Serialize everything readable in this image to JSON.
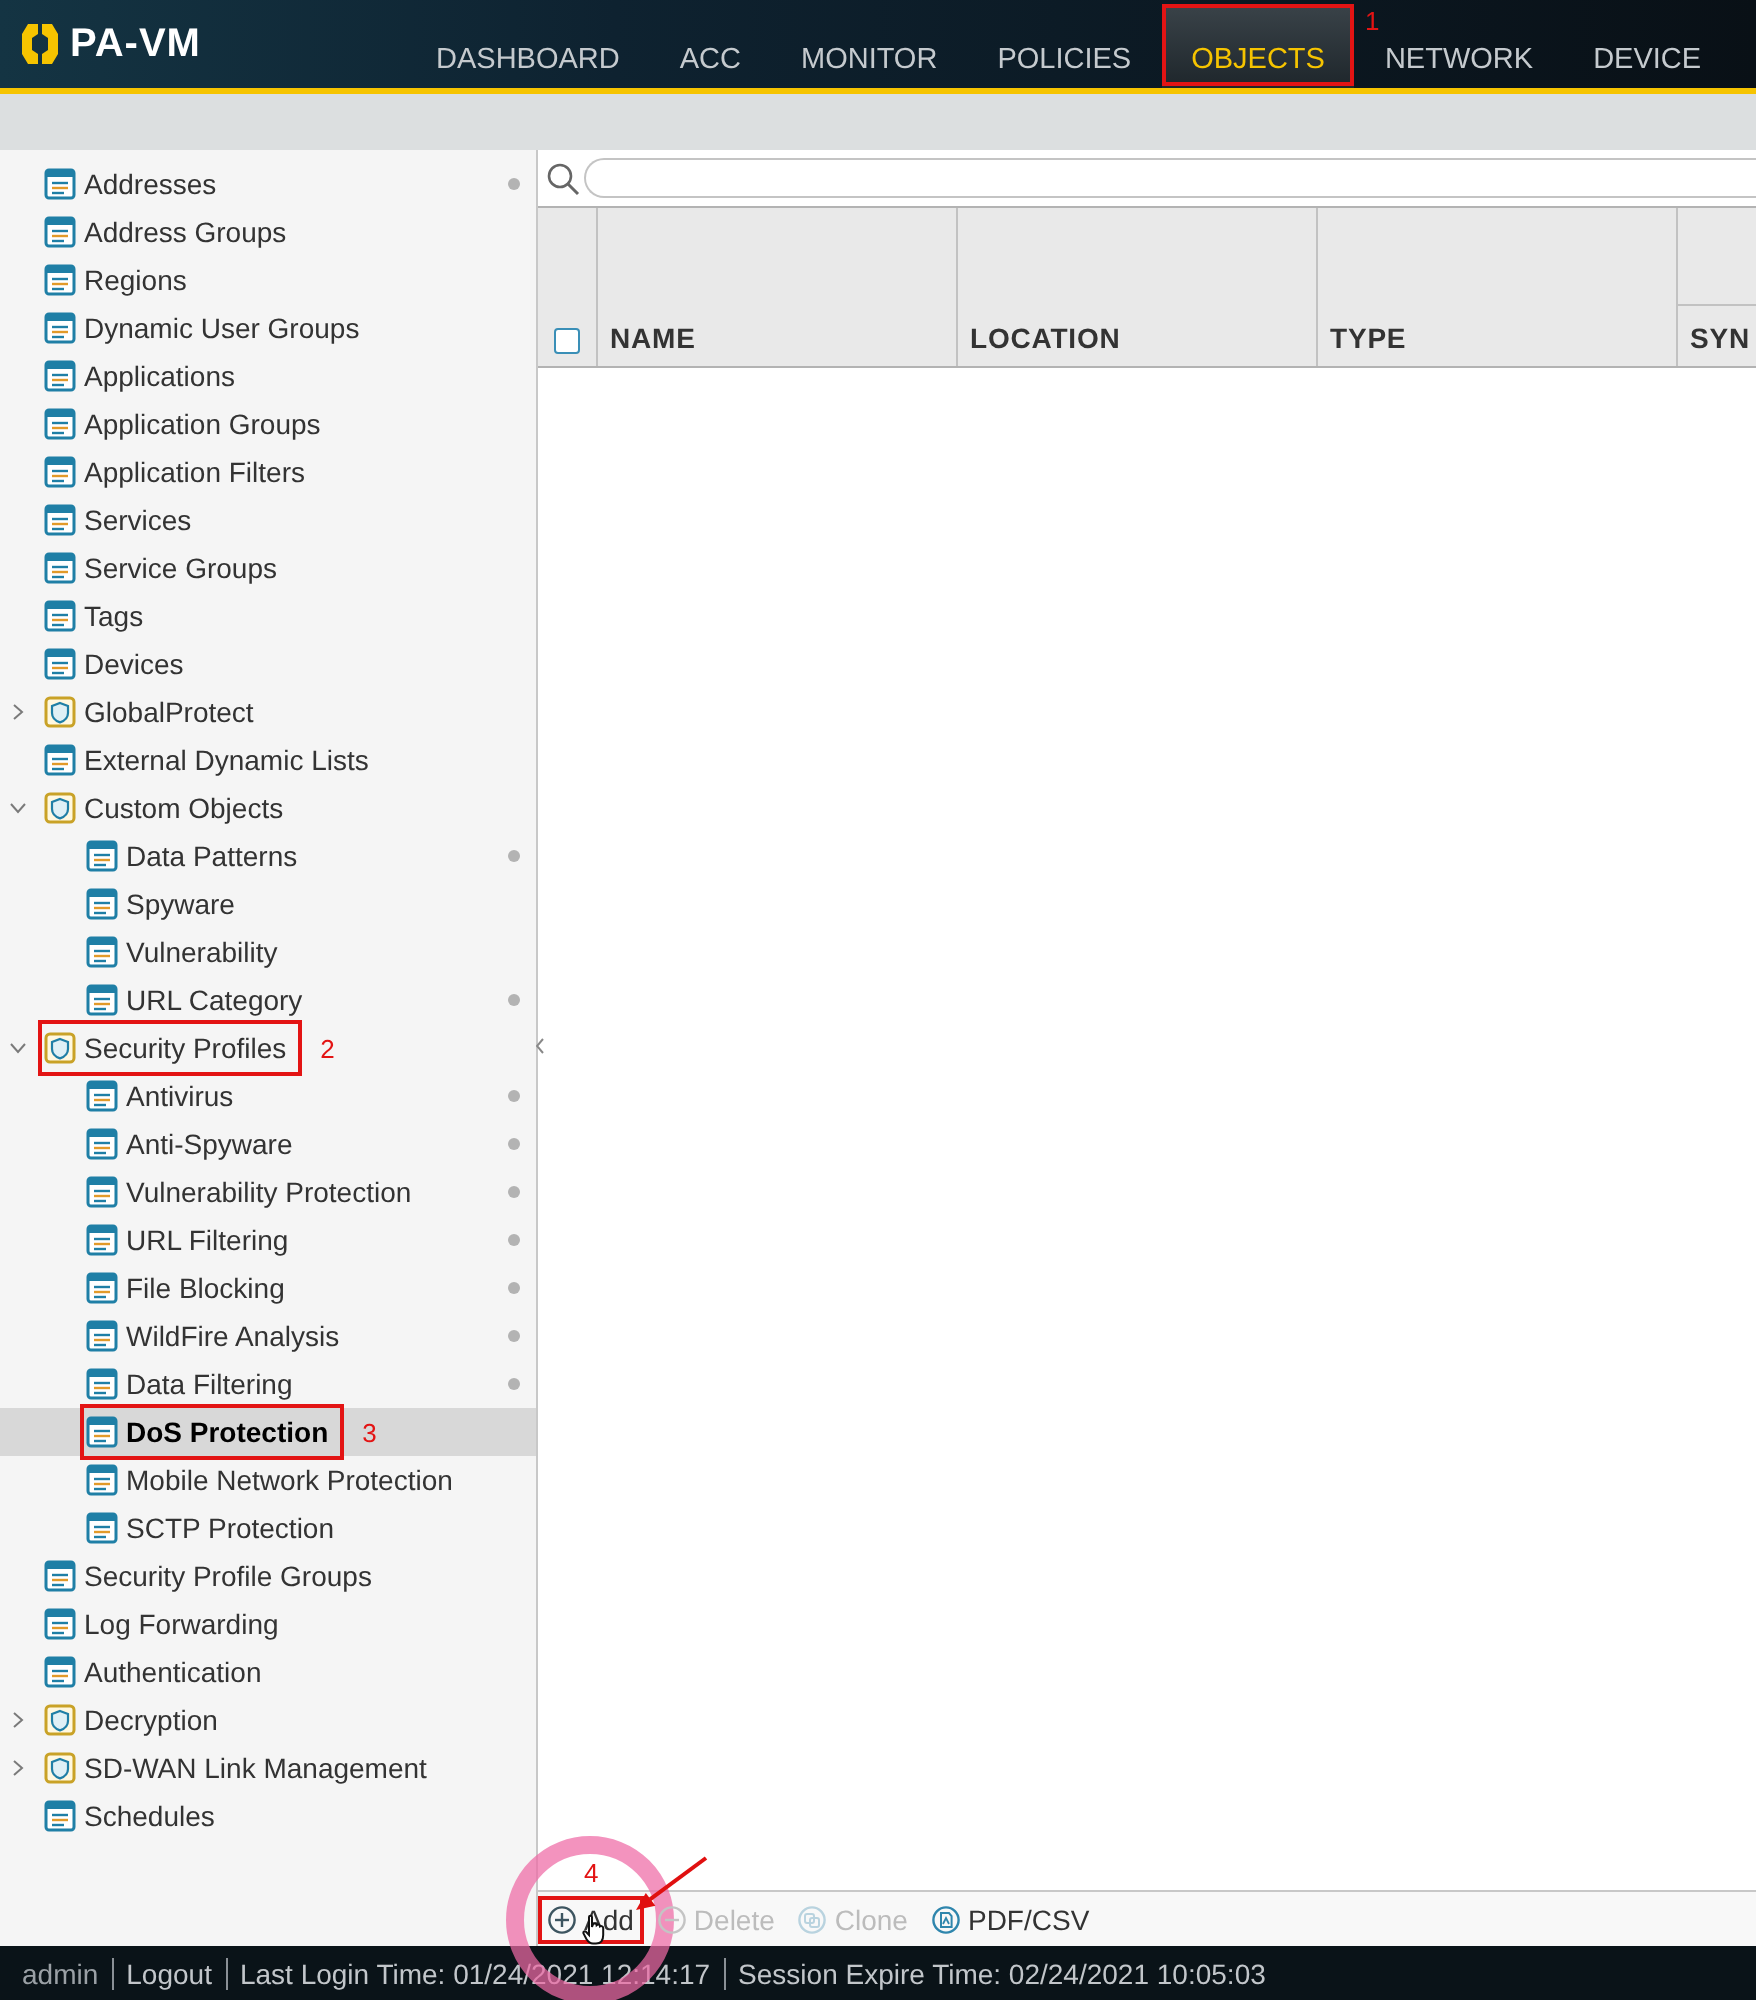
{
  "app": {
    "logo": "PA-VM"
  },
  "nav_tabs": [
    {
      "label": "DASHBOARD",
      "selected": false
    },
    {
      "label": "ACC",
      "selected": false
    },
    {
      "label": "MONITOR",
      "selected": false
    },
    {
      "label": "POLICIES",
      "selected": false
    },
    {
      "label": "OBJECTS",
      "selected": true,
      "callout": "1"
    },
    {
      "label": "NETWORK",
      "selected": false
    },
    {
      "label": "DEVICE",
      "selected": false
    }
  ],
  "sidebar": {
    "items": [
      {
        "label": "Addresses",
        "kind": "leaf",
        "selected": false,
        "marked": true
      },
      {
        "label": "Address Groups",
        "kind": "leaf",
        "selected": false,
        "marked": false
      },
      {
        "label": "Regions",
        "kind": "leaf",
        "selected": false,
        "marked": false
      },
      {
        "label": "Dynamic User Groups",
        "kind": "leaf",
        "selected": false,
        "marked": false
      },
      {
        "label": "Applications",
        "kind": "leaf",
        "selected": false,
        "marked": false
      },
      {
        "label": "Application Groups",
        "kind": "leaf",
        "selected": false,
        "marked": false
      },
      {
        "label": "Application Filters",
        "kind": "leaf",
        "selected": false,
        "marked": false
      },
      {
        "label": "Services",
        "kind": "leaf",
        "selected": false,
        "marked": false
      },
      {
        "label": "Service Groups",
        "kind": "leaf",
        "selected": false,
        "marked": false
      },
      {
        "label": "Tags",
        "kind": "leaf",
        "selected": false,
        "marked": false
      },
      {
        "label": "Devices",
        "kind": "leaf",
        "selected": false,
        "marked": false
      },
      {
        "label": "GlobalProtect",
        "kind": "folder",
        "expanded": false,
        "selected": false,
        "marked": false
      },
      {
        "label": "External Dynamic Lists",
        "kind": "leaf",
        "selected": false,
        "marked": false
      },
      {
        "label": "Custom Objects",
        "kind": "folder",
        "expanded": true,
        "selected": false,
        "marked": false,
        "children": [
          {
            "label": "Data Patterns",
            "kind": "leaf",
            "selected": false,
            "marked": true
          },
          {
            "label": "Spyware",
            "kind": "leaf",
            "selected": false,
            "marked": false
          },
          {
            "label": "Vulnerability",
            "kind": "leaf",
            "selected": false,
            "marked": false
          },
          {
            "label": "URL Category",
            "kind": "leaf",
            "selected": false,
            "marked": true
          }
        ]
      },
      {
        "label": "Security Profiles",
        "kind": "folder",
        "expanded": true,
        "selected": false,
        "marked": false,
        "callout": "2",
        "children": [
          {
            "label": "Antivirus",
            "kind": "leaf",
            "selected": false,
            "marked": true
          },
          {
            "label": "Anti-Spyware",
            "kind": "leaf",
            "selected": false,
            "marked": true
          },
          {
            "label": "Vulnerability Protection",
            "kind": "leaf",
            "selected": false,
            "marked": true
          },
          {
            "label": "URL Filtering",
            "kind": "leaf",
            "selected": false,
            "marked": true
          },
          {
            "label": "File Blocking",
            "kind": "leaf",
            "selected": false,
            "marked": true
          },
          {
            "label": "WildFire Analysis",
            "kind": "leaf",
            "selected": false,
            "marked": true
          },
          {
            "label": "Data Filtering",
            "kind": "leaf",
            "selected": false,
            "marked": true
          },
          {
            "label": "DoS Protection",
            "kind": "leaf",
            "selected": true,
            "marked": false,
            "callout": "3"
          },
          {
            "label": "Mobile Network Protection",
            "kind": "leaf",
            "selected": false,
            "marked": false
          },
          {
            "label": "SCTP Protection",
            "kind": "leaf",
            "selected": false,
            "marked": false
          }
        ]
      },
      {
        "label": "Security Profile Groups",
        "kind": "leaf",
        "selected": false,
        "marked": false
      },
      {
        "label": "Log Forwarding",
        "kind": "leaf",
        "selected": false,
        "marked": false
      },
      {
        "label": "Authentication",
        "kind": "leaf",
        "selected": false,
        "marked": false
      },
      {
        "label": "Decryption",
        "kind": "folder",
        "expanded": false,
        "selected": false,
        "marked": false
      },
      {
        "label": "SD-WAN Link Management",
        "kind": "folder",
        "expanded": false,
        "selected": false,
        "marked": false
      },
      {
        "label": "Schedules",
        "kind": "leaf",
        "selected": false,
        "marked": false
      }
    ]
  },
  "table": {
    "select_all": {
      "checked": false
    },
    "columns": [
      {
        "label": "NAME",
        "kind": "plain"
      },
      {
        "label": "LOCATION",
        "kind": "plain"
      },
      {
        "label": "TYPE",
        "kind": "plain"
      },
      {
        "label": "SYN",
        "kind": "grouped"
      }
    ]
  },
  "toolbar": {
    "buttons": [
      {
        "label": "Add",
        "kind": "add",
        "disabled": false,
        "callout": "4"
      },
      {
        "label": "Delete",
        "kind": "delete",
        "disabled": true
      },
      {
        "label": "Clone",
        "kind": "clone",
        "disabled": true
      },
      {
        "label": "PDF/CSV",
        "kind": "export",
        "disabled": false
      }
    ]
  },
  "status_bar": {
    "user": "admin",
    "logout": "Logout",
    "items": [
      "Last Login Time: 01/24/2021 12:14:17",
      "Session Expire Time: 02/24/2021 10:05:03"
    ]
  }
}
